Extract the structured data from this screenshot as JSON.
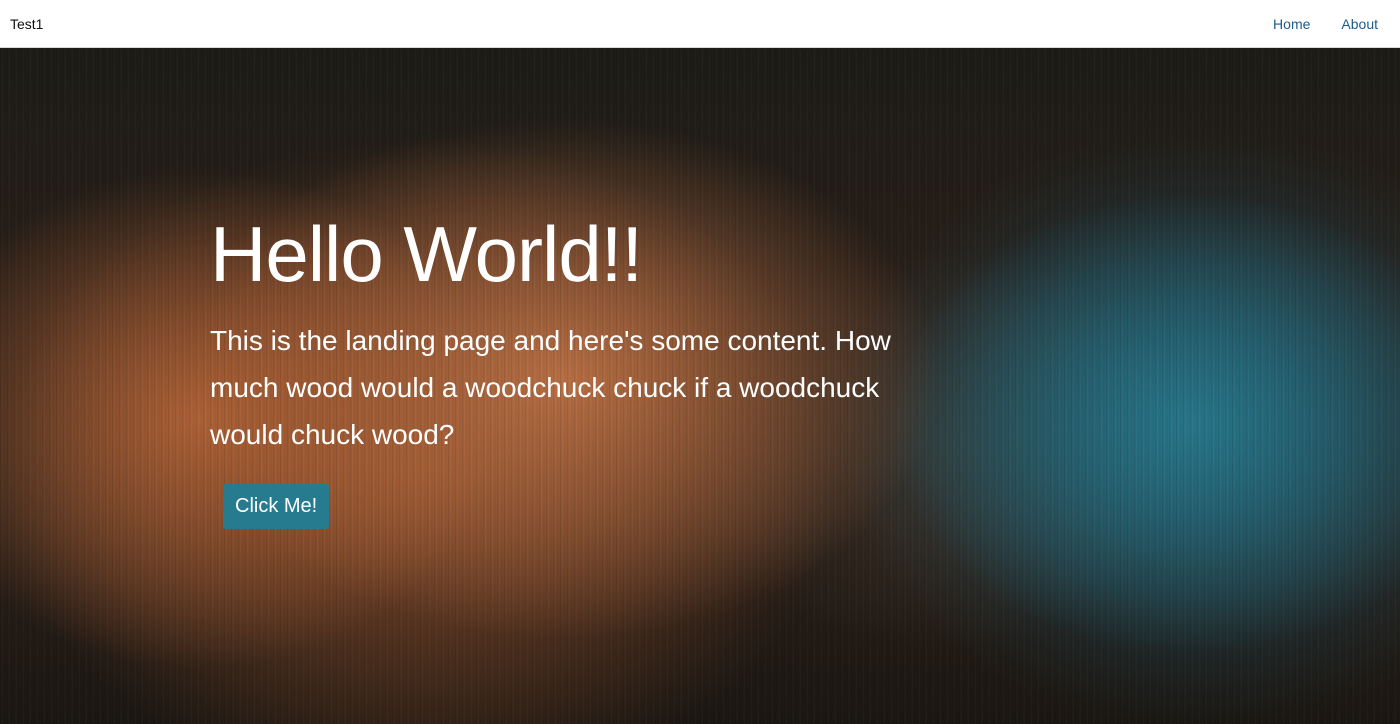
{
  "navbar": {
    "brand": "Test1",
    "links": [
      {
        "label": "Home"
      },
      {
        "label": "About"
      }
    ],
    "link_color": "#1d5c8a"
  },
  "hero": {
    "title": "Hello World!!",
    "text": "This is the landing page and here's some content. How much wood would a woodchuck chuck if a woodchuck would chuck wood?",
    "button_label": "Click Me!",
    "button_color": "#277b8e",
    "background_colors": {
      "warm": "#b46538",
      "cool": "#28788c",
      "dark": "#1c1b16"
    }
  }
}
